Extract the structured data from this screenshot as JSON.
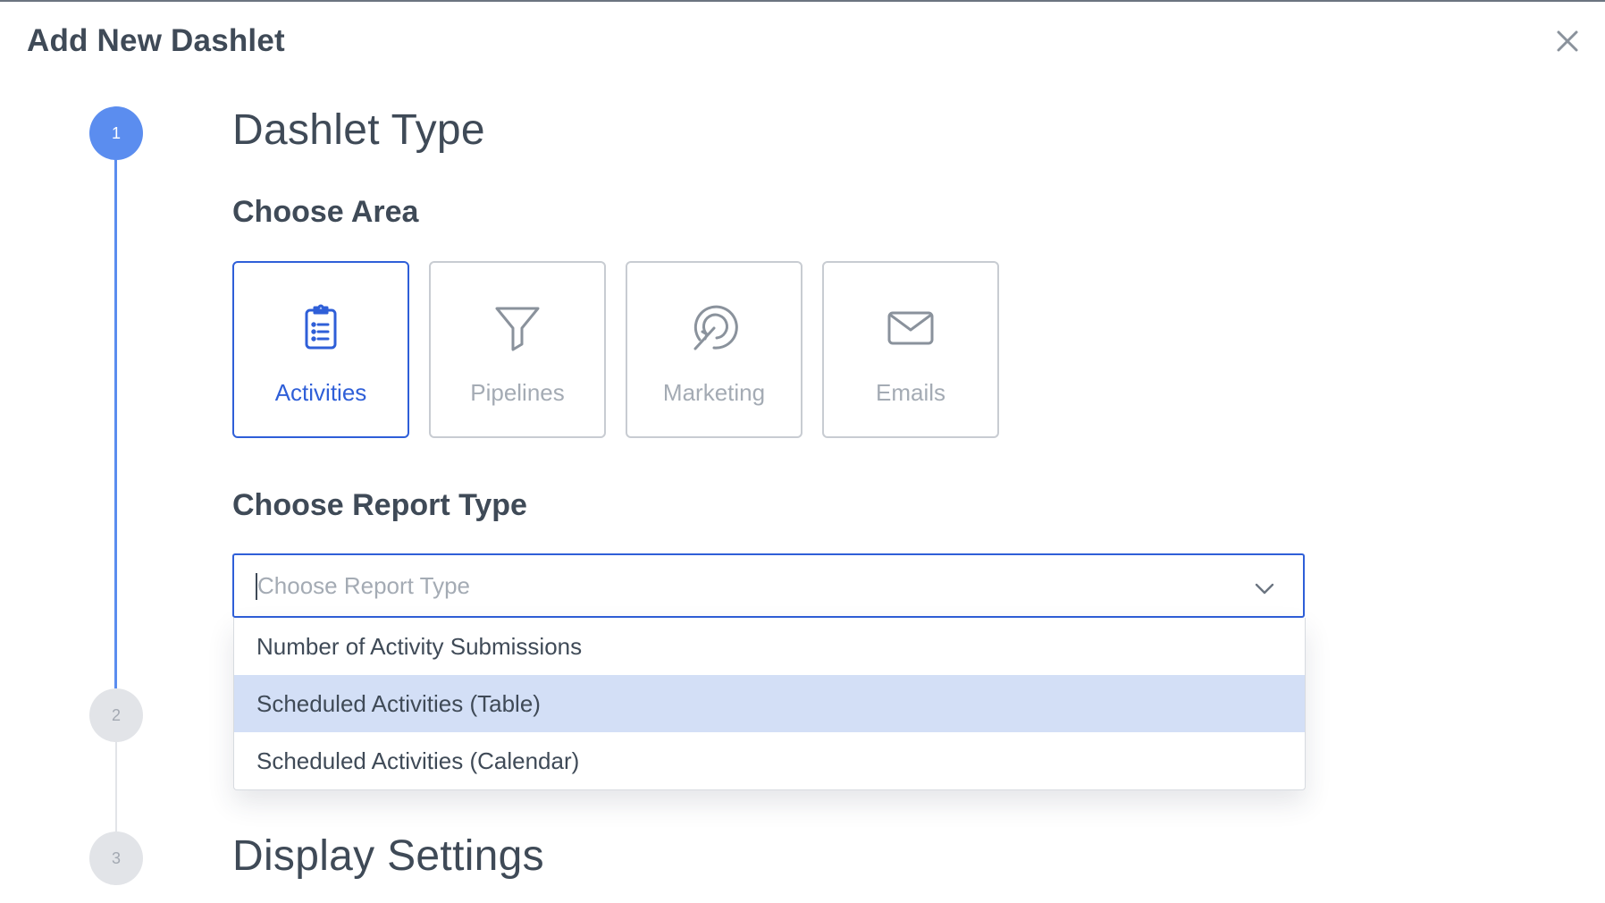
{
  "modal": {
    "title": "Add New Dashlet",
    "close_icon": "close-icon"
  },
  "stepper": {
    "steps": [
      {
        "number": "1",
        "state": "active"
      },
      {
        "number": "2",
        "state": "inactive"
      },
      {
        "number": "3",
        "state": "inactive"
      }
    ]
  },
  "sections": {
    "dashlet_type": "Dashlet Type",
    "display_settings": "Display Settings"
  },
  "choose_area": {
    "heading": "Choose Area",
    "options": [
      {
        "label": "Activities",
        "icon": "clipboard-list-icon",
        "selected": true
      },
      {
        "label": "Pipelines",
        "icon": "funnel-icon",
        "selected": false
      },
      {
        "label": "Marketing",
        "icon": "target-arrow-icon",
        "selected": false
      },
      {
        "label": "Emails",
        "icon": "envelope-icon",
        "selected": false
      }
    ]
  },
  "report_type": {
    "heading": "Choose Report Type",
    "placeholder": "Choose Report Type",
    "value": "",
    "highlighted_index": 1,
    "options": [
      "Number of Activity Submissions",
      "Scheduled Activities (Table)",
      "Scheduled Activities (Calendar)"
    ]
  },
  "colors": {
    "accent": "#2f5fd8",
    "step_active": "#5b8def",
    "step_inactive": "#e2e4e8",
    "option_highlight": "#d3dff6",
    "text": "#3f4a57",
    "muted": "#a4abb4"
  }
}
